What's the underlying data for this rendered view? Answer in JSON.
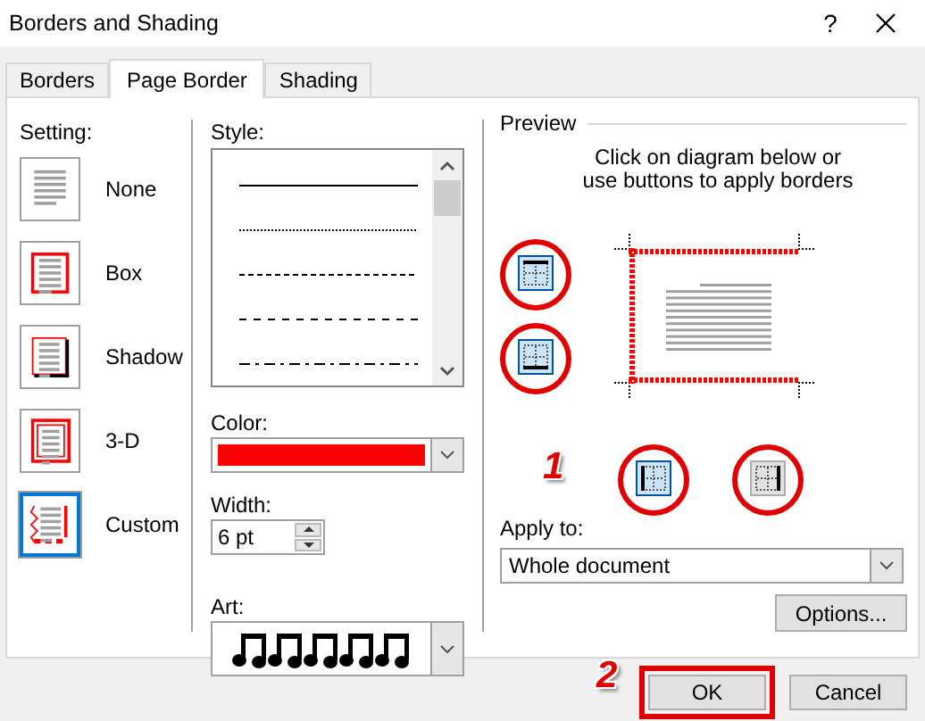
{
  "window": {
    "title": "Borders and Shading",
    "help": "?"
  },
  "tabs": [
    {
      "label": "Borders",
      "selected": false
    },
    {
      "label": "Page Border",
      "selected": true
    },
    {
      "label": "Shading",
      "selected": false
    }
  ],
  "setting": {
    "label": "Setting:",
    "options": [
      {
        "label": "None",
        "kind": "none",
        "selected": false
      },
      {
        "label": "Box",
        "kind": "box",
        "selected": false
      },
      {
        "label": "Shadow",
        "kind": "shadow",
        "selected": false
      },
      {
        "label": "3-D",
        "kind": "double",
        "selected": false
      },
      {
        "label": "Custom",
        "kind": "custom",
        "selected": true
      }
    ]
  },
  "style": {
    "label": "Style:",
    "lines": [
      {
        "kind": "solid"
      },
      {
        "kind": "dotted"
      },
      {
        "kind": "fine-dashed"
      },
      {
        "kind": "dashed"
      },
      {
        "kind": "dash-dot"
      }
    ]
  },
  "color": {
    "label": "Color:",
    "color": "#ff0000"
  },
  "width": {
    "label": "Width:",
    "value": "6 pt"
  },
  "art": {
    "label": "Art:"
  },
  "preview": {
    "label": "Preview",
    "hint": "Click on diagram below or use buttons to apply borders",
    "border_buttons": [
      {
        "kind": "top",
        "pressed": true,
        "highlighted": true
      },
      {
        "kind": "bottom",
        "pressed": true,
        "highlighted": true
      },
      {
        "kind": "left",
        "pressed": true,
        "highlighted": true
      },
      {
        "kind": "right",
        "pressed": false,
        "highlighted": true
      }
    ],
    "step_label": "1"
  },
  "apply_to": {
    "label": "Apply to:",
    "value": "Whole document"
  },
  "options_button": "Options...",
  "buttons": [
    {
      "label": "OK",
      "highlighted": true
    },
    {
      "label": "Cancel",
      "highlighted": false
    }
  ],
  "step_label": "2"
}
